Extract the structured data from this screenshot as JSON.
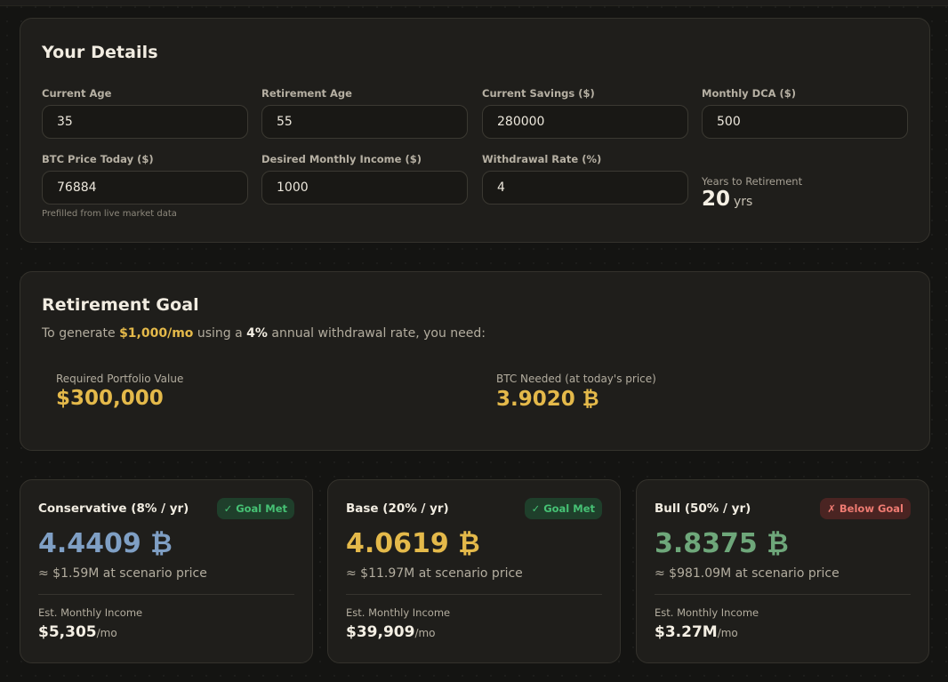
{
  "details": {
    "title": "Your Details",
    "fields": [
      {
        "label": "Current Age",
        "value": "35"
      },
      {
        "label": "Retirement Age",
        "value": "55"
      },
      {
        "label": "Current Savings ($)",
        "value": "280000"
      },
      {
        "label": "Monthly DCA ($)",
        "value": "500"
      },
      {
        "label": "BTC Price Today ($)",
        "value": "76884",
        "hint": "Prefilled from live market data"
      },
      {
        "label": "Desired Monthly Income ($)",
        "value": "1000"
      },
      {
        "label": "Withdrawal Rate (%)",
        "value": "4"
      }
    ],
    "years_to_retirement": {
      "label": "Years to Retirement",
      "value": "20",
      "unit": "yrs"
    }
  },
  "goal": {
    "title": "Retirement Goal",
    "sentence": {
      "prefix": "To generate ",
      "income": "$1,000/mo",
      "middle": " using a ",
      "rate": "4%",
      "suffix": " annual withdrawal rate, you need:"
    },
    "required_value": {
      "label": "Required Portfolio Value",
      "value": "$300,000"
    },
    "btc_needed": {
      "label": "BTC Needed (at today's price)",
      "value": "3.9020 ₿"
    }
  },
  "scenarios": [
    {
      "name": "Conservative (8% / yr)",
      "badge": "✓ Goal Met",
      "btc": "4.4409 ₿",
      "btc_color": "#7f9fc4",
      "approx": "≈ $1.59M at scenario price",
      "income_label": "Est. Monthly Income",
      "income": "$5,305",
      "income_unit": "/mo"
    },
    {
      "name": "Base (20% / yr)",
      "badge": "✓ Goal Met",
      "btc": "4.0619 ₿",
      "btc_color": "#e4b94a",
      "approx": "≈ $11.97M at scenario price",
      "income_label": "Est. Monthly Income",
      "income": "$39,909",
      "income_unit": "/mo"
    },
    {
      "name": "Bull (50% / yr)",
      "badge": "✗ Below Goal",
      "btc": "3.8375 ₿",
      "btc_color": "#6ea77a",
      "approx": "≈ $981.09M at scenario price",
      "income_label": "Est. Monthly Income",
      "income": "$3.27M",
      "income_unit": "/mo"
    }
  ]
}
